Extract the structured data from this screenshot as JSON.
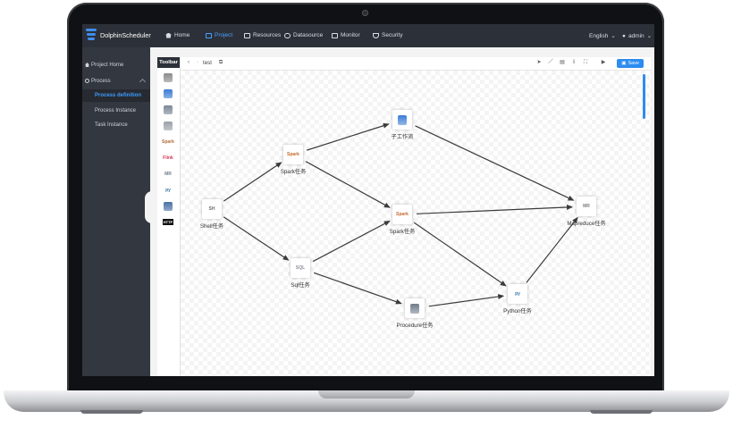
{
  "app": {
    "name": "DolphinScheduler"
  },
  "topnav": {
    "items": [
      {
        "label": "Home",
        "icon": "home-icon",
        "active": false
      },
      {
        "label": "Project",
        "icon": "folder-icon",
        "active": true
      },
      {
        "label": "Resources",
        "icon": "folder-icon",
        "active": false
      },
      {
        "label": "Datasource",
        "icon": "database-icon",
        "active": false
      },
      {
        "label": "Monitor",
        "icon": "monitor-icon",
        "active": false
      },
      {
        "label": "Security",
        "icon": "shield-icon",
        "active": false
      }
    ],
    "language": "English",
    "user": "admin"
  },
  "sidebar": {
    "items": [
      {
        "label": "Project Home"
      },
      {
        "label": "Process"
      },
      {
        "label": "Process definition",
        "active": true
      },
      {
        "label": "Process Instance"
      },
      {
        "label": "Task Instance"
      }
    ]
  },
  "toolbar": {
    "title": "Toolbar",
    "tools": [
      {
        "name": "shell-tool",
        "glyph": ""
      },
      {
        "name": "sub-process-tool",
        "glyph": ""
      },
      {
        "name": "procedure-tool",
        "glyph": ""
      },
      {
        "name": "sql-tool",
        "glyph": ""
      },
      {
        "name": "spark-tool",
        "glyph": "Spark"
      },
      {
        "name": "flink-tool",
        "glyph": "Flink"
      },
      {
        "name": "mapreduce-tool",
        "glyph": "MR"
      },
      {
        "name": "python-tool",
        "glyph": "py"
      },
      {
        "name": "dependent-tool",
        "glyph": ""
      },
      {
        "name": "http-tool",
        "glyph": "HTTP"
      }
    ]
  },
  "editor": {
    "process_name": "test",
    "save_label": "Save"
  },
  "graph": {
    "nodes": [
      {
        "id": "shell",
        "label": "Shell任务",
        "glyph": "SH"
      },
      {
        "id": "spark1",
        "label": "Spark任务",
        "glyph": "Spark"
      },
      {
        "id": "sql",
        "label": "Sql任务",
        "glyph": "SQL"
      },
      {
        "id": "sub",
        "label": "子工作流",
        "glyph": ""
      },
      {
        "id": "spark2",
        "label": "Spark任务",
        "glyph": "Spark"
      },
      {
        "id": "proc",
        "label": "Procedure任务",
        "glyph": ""
      },
      {
        "id": "python",
        "label": "Python任务",
        "glyph": "py"
      },
      {
        "id": "mr",
        "label": "Mapreduce任务",
        "glyph": "MR"
      }
    ],
    "edges": [
      [
        "shell",
        "spark1"
      ],
      [
        "shell",
        "sql"
      ],
      [
        "spark1",
        "sub"
      ],
      [
        "spark1",
        "spark2"
      ],
      [
        "sql",
        "spark2"
      ],
      [
        "sql",
        "proc"
      ],
      [
        "sub",
        "mr"
      ],
      [
        "spark2",
        "mr"
      ],
      [
        "spark2",
        "python"
      ],
      [
        "proc",
        "python"
      ],
      [
        "python",
        "mr"
      ]
    ]
  },
  "colors": {
    "accent": "#2d8cf0",
    "nav_bg": "#2c3038",
    "sidebar_bg": "#33373f"
  }
}
